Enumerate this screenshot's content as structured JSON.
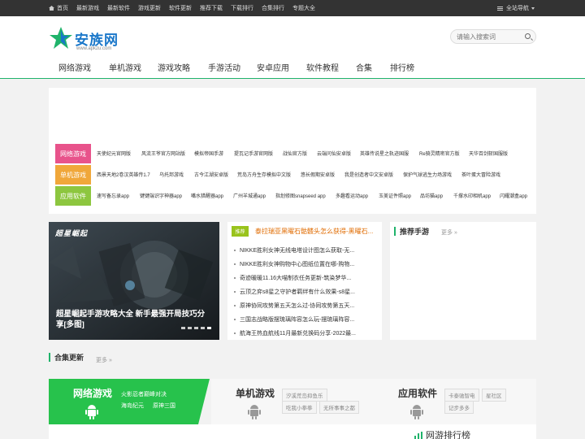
{
  "topbar": {
    "nav": [
      "首页",
      "最新游戏",
      "最新软件",
      "游戏更新",
      "软件更新",
      "推荐下载",
      "下载排行",
      "合集排行",
      "专题大全"
    ],
    "site_nav": "全站导航"
  },
  "logo": {
    "brand": "安族网",
    "domain": "www.apkzu.com"
  },
  "search": {
    "placeholder": "请输入搜索词"
  },
  "mainnav": [
    "网络游戏",
    "单机游戏",
    "游戏攻略",
    "手游活动",
    "安卓应用",
    "软件教程",
    "合集",
    "排行榜"
  ],
  "categories": [
    {
      "label": "网络游戏",
      "color": "#e8538b",
      "links": [
        "天使纪元官网版",
        "风流王爷官方网站版",
        "模拟帝国手游",
        "提瓦记手游官网版",
        "战仙官方版",
        "云端问仙安卓版",
        "英雄传说星之轨迹国服",
        "Re骑灵精密官方版",
        "天华百剑斩国服版"
      ]
    },
    {
      "label": "单机游戏",
      "color": "#f0a73a",
      "links": [
        "西景天地2卷汉英雄传1.7",
        "乌托邦游戏",
        "古今江湖安卓版",
        "荒岛方舟生存模拟中文版",
        "悠长假期安卓版",
        "我是创造者中文安卓版",
        "保护气球逃生力场游戏",
        "茶叶蛋大冒险游戏"
      ]
    },
    {
      "label": "应用软件",
      "color": "#8dc63f",
      "links": [
        "速写备忘录app",
        "键键端识字神器app",
        "嘴水猎醒器app",
        "广州羊城通app",
        "指划修图snapseed app",
        "多趣看运动app",
        "玉美证件照app",
        "品坊猫app",
        "千撑水印相机app",
        "闪耀潮盒app"
      ]
    }
  ],
  "banner": {
    "logo_text": "超星崛起",
    "caption": "超星崛起手游攻略大全 新手最强开局技巧分享[多图]"
  },
  "news": {
    "tag": "推荐",
    "headline": "泰拉瑞亚黑曜石骷髅头怎么获得-黑曜石...",
    "items": [
      "NIKKE胜利女神无线电塔设计图怎么获取-无...",
      "NIKKE胜利女神购物中心图纸位置在哪-购物...",
      "奇迹暖暖11.16大喵制衣任务更新-筑染梦华...",
      "云顶之弈s8星之守护者羁绊有什么效果-s8星...",
      "原神协同攻势第五天怎么过-协同攻势第五天...",
      "三国志战略版摆琉璃阵容怎么玩-摆琉璃阵容...",
      "航海王热血航线11月最新兑换码分享-2022最..."
    ]
  },
  "recommend": {
    "title": "推荐手游",
    "more": "更多 »"
  },
  "collections": {
    "title": "合集更新",
    "more": "更多 »",
    "cards": [
      {
        "title": "网络游戏",
        "tags": [
          "火影忍者巅峰对决",
          "海岛纪元",
          "原神三国"
        ]
      },
      {
        "title": "单机游戏",
        "tags": [
          "汐溪荒岛抑鱼乐",
          "吃我小拳拳",
          "无所事事之都"
        ]
      },
      {
        "title": "应用软件",
        "tags": [
          "卡泰驰智电",
          "星社区",
          "记步多多"
        ]
      }
    ]
  },
  "ranking": {
    "title": "网游排行榜"
  },
  "colors": {
    "accent": "#1fb36b",
    "brand_blue": "#1a77c9",
    "orange": "#e06b00",
    "dark": "#333333"
  }
}
